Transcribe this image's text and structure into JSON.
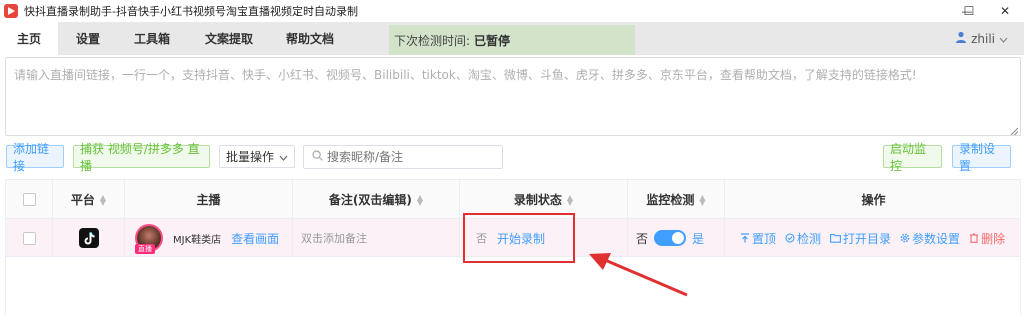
{
  "window": {
    "title": "快抖直播录制助手-抖音快手小红书视频号淘宝直播视频定时自动录制",
    "minimize_label": "—",
    "maximize_label": "☐",
    "close_label": "✕"
  },
  "tabs": [
    {
      "label": "主页",
      "active": true
    },
    {
      "label": "设置"
    },
    {
      "label": "工具箱"
    },
    {
      "label": "文案提取"
    },
    {
      "label": "帮助文档"
    }
  ],
  "status": {
    "label": "下次检测时间:",
    "value": "已暂停"
  },
  "user": {
    "name": "zhili"
  },
  "link_input": {
    "placeholder": "请输入直播间链接，一行一个，支持抖音、快手、小红书、视频号、Bilibili、tiktok、淘宝、微博、斗鱼、虎牙、拼多多、京东平台，查看帮助文档，了解支持的链接格式!"
  },
  "toolbar": {
    "add_link": "添加链接",
    "capture": "捕获 视频号/拼多多 直播",
    "batch": "批量操作",
    "search_placeholder": "搜索昵称/备注",
    "start_monitor": "启动监控",
    "record_settings": "录制设置"
  },
  "table": {
    "headers": {
      "platform": "平台",
      "anchor": "主播",
      "remark": "备注(双击编辑)",
      "record_status": "录制状态",
      "monitor": "监控检测",
      "actions": "操作"
    },
    "rows": [
      {
        "platform": "tiktok-icon",
        "live_tag": "直播",
        "anchor_name": "MJK鞋类店",
        "view_link": "查看画面",
        "remark": "双击添加备注",
        "record_flag": "否",
        "record_action": "开始录制",
        "monitor_off": "否",
        "monitor_on": "是",
        "monitor_enabled": true,
        "actions": [
          "置顶",
          "检测",
          "打开目录",
          "参数设置",
          "删除"
        ]
      }
    ]
  },
  "colors": {
    "accent": "#409eff",
    "success": "#67c23a",
    "danger": "#f56c6c",
    "highlight": "#e03030",
    "status_bg": "#d2e3ca",
    "row_bg": "#fbf1f7"
  }
}
